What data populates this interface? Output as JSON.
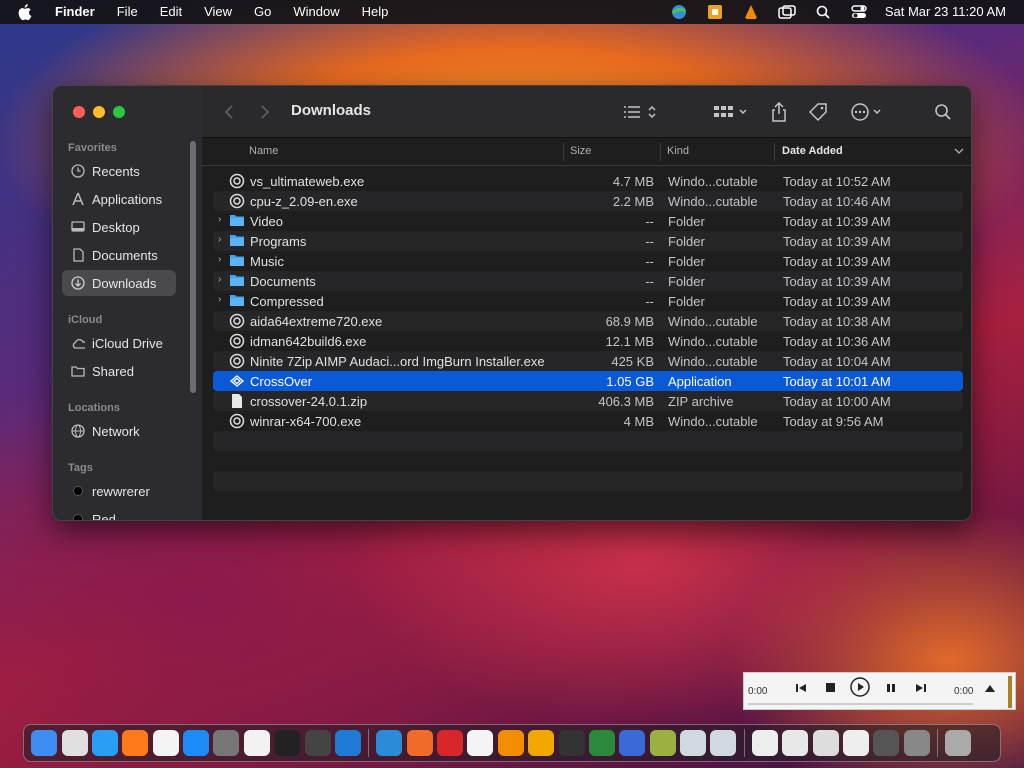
{
  "menubar": {
    "app": "Finder",
    "items": [
      "File",
      "Edit",
      "View",
      "Go",
      "Window",
      "Help"
    ],
    "datetime": "Sat Mar 23  11:20 AM"
  },
  "sidebar": {
    "favorites_label": "Favorites",
    "favorites": [
      {
        "label": "Recents",
        "icon": "clock-icon"
      },
      {
        "label": "Applications",
        "icon": "applications-icon"
      },
      {
        "label": "Desktop",
        "icon": "desktop-icon"
      },
      {
        "label": "Documents",
        "icon": "document-icon"
      },
      {
        "label": "Downloads",
        "icon": "download-icon",
        "active": true
      }
    ],
    "icloud_label": "iCloud",
    "icloud": [
      {
        "label": "iCloud Drive",
        "icon": "cloud-icon"
      },
      {
        "label": "Shared",
        "icon": "shared-folder-icon"
      }
    ],
    "locations_label": "Locations",
    "locations": [
      {
        "label": "Network",
        "icon": "globe-icon"
      }
    ],
    "tags_label": "Tags",
    "tags": [
      {
        "label": "rewwrerer",
        "color": "#000000"
      },
      {
        "label": "Red",
        "color": "#000000"
      }
    ]
  },
  "toolbar": {
    "title": "Downloads"
  },
  "columns": {
    "name": "Name",
    "size": "Size",
    "kind": "Kind",
    "date": "Date Added"
  },
  "files": [
    {
      "name": "vs_ultimateweb.exe",
      "size": "4.7 MB",
      "kind": "Windo...cutable",
      "date": "Today at 10:52 AM",
      "type": "exe"
    },
    {
      "name": "cpu-z_2.09-en.exe",
      "size": "2.2 MB",
      "kind": "Windo...cutable",
      "date": "Today at 10:46 AM",
      "type": "exe"
    },
    {
      "name": "Video",
      "size": "--",
      "kind": "Folder",
      "date": "Today at 10:39 AM",
      "type": "folder"
    },
    {
      "name": "Programs",
      "size": "--",
      "kind": "Folder",
      "date": "Today at 10:39 AM",
      "type": "folder"
    },
    {
      "name": "Music",
      "size": "--",
      "kind": "Folder",
      "date": "Today at 10:39 AM",
      "type": "folder"
    },
    {
      "name": "Documents",
      "size": "--",
      "kind": "Folder",
      "date": "Today at 10:39 AM",
      "type": "folder"
    },
    {
      "name": "Compressed",
      "size": "--",
      "kind": "Folder",
      "date": "Today at 10:39 AM",
      "type": "folder"
    },
    {
      "name": "aida64extreme720.exe",
      "size": "68.9 MB",
      "kind": "Windo...cutable",
      "date": "Today at 10:38 AM",
      "type": "exe"
    },
    {
      "name": "idman642build6.exe",
      "size": "12.1 MB",
      "kind": "Windo...cutable",
      "date": "Today at 10:36 AM",
      "type": "exe"
    },
    {
      "name": "Ninite 7Zip AIMP Audaci...ord ImgBurn Installer.exe",
      "size": "425 KB",
      "kind": "Windo...cutable",
      "date": "Today at 10:04 AM",
      "type": "exe"
    },
    {
      "name": "CrossOver",
      "size": "1.05 GB",
      "kind": "Application",
      "date": "Today at 10:01 AM",
      "type": "app",
      "selected": true
    },
    {
      "name": "crossover-24.0.1.zip",
      "size": "406.3 MB",
      "kind": "ZIP archive",
      "date": "Today at 10:00 AM",
      "type": "zip"
    },
    {
      "name": "winrar-x64-700.exe",
      "size": "4 MB",
      "kind": "Windo...cutable",
      "date": "Today at 9:56 AM",
      "type": "exe"
    }
  ],
  "player": {
    "elapsed": "0:00",
    "total": "0:00"
  },
  "dock": [
    "Finder",
    "Launchpad",
    "Safari",
    "Firefox",
    "Chrome",
    "App Store",
    "System Settings",
    "TextEdit",
    "Terminal",
    "Brush",
    "VS Code",
    "iCloud",
    "Preview",
    "WPS",
    "Cal",
    "VLC",
    "Avast",
    "CrossOver",
    "Internet",
    "Help",
    "Archive",
    "Disk",
    "Disk2",
    "Doc",
    "Doc2",
    "Doc3",
    "Doc4",
    "Doc5",
    "Doc6",
    "Trash"
  ]
}
